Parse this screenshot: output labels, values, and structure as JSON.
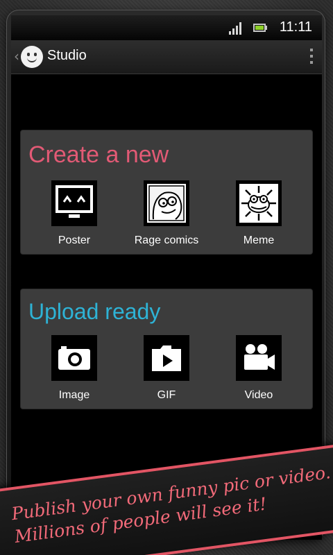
{
  "status_bar": {
    "time": "11:11"
  },
  "action_bar": {
    "title": "Studio"
  },
  "create_section": {
    "title": "Create a new",
    "title_color": "#e25a75",
    "items": [
      {
        "label": "Poster",
        "icon": "poster-icon"
      },
      {
        "label": "Rage comics",
        "icon": "rage-face-icon"
      },
      {
        "label": "Meme",
        "icon": "meme-frog-icon"
      }
    ]
  },
  "upload_section": {
    "title": "Upload ready",
    "title_color": "#2eb3d6",
    "items": [
      {
        "label": "Image",
        "icon": "camera-icon"
      },
      {
        "label": "GIF",
        "icon": "gif-folder-icon"
      },
      {
        "label": "Video",
        "icon": "video-camera-icon"
      }
    ]
  },
  "promo_banner": {
    "line1": "Publish your own funny pic or video.",
    "line2": "Millions of people will see it!",
    "accent": "#e25564"
  }
}
